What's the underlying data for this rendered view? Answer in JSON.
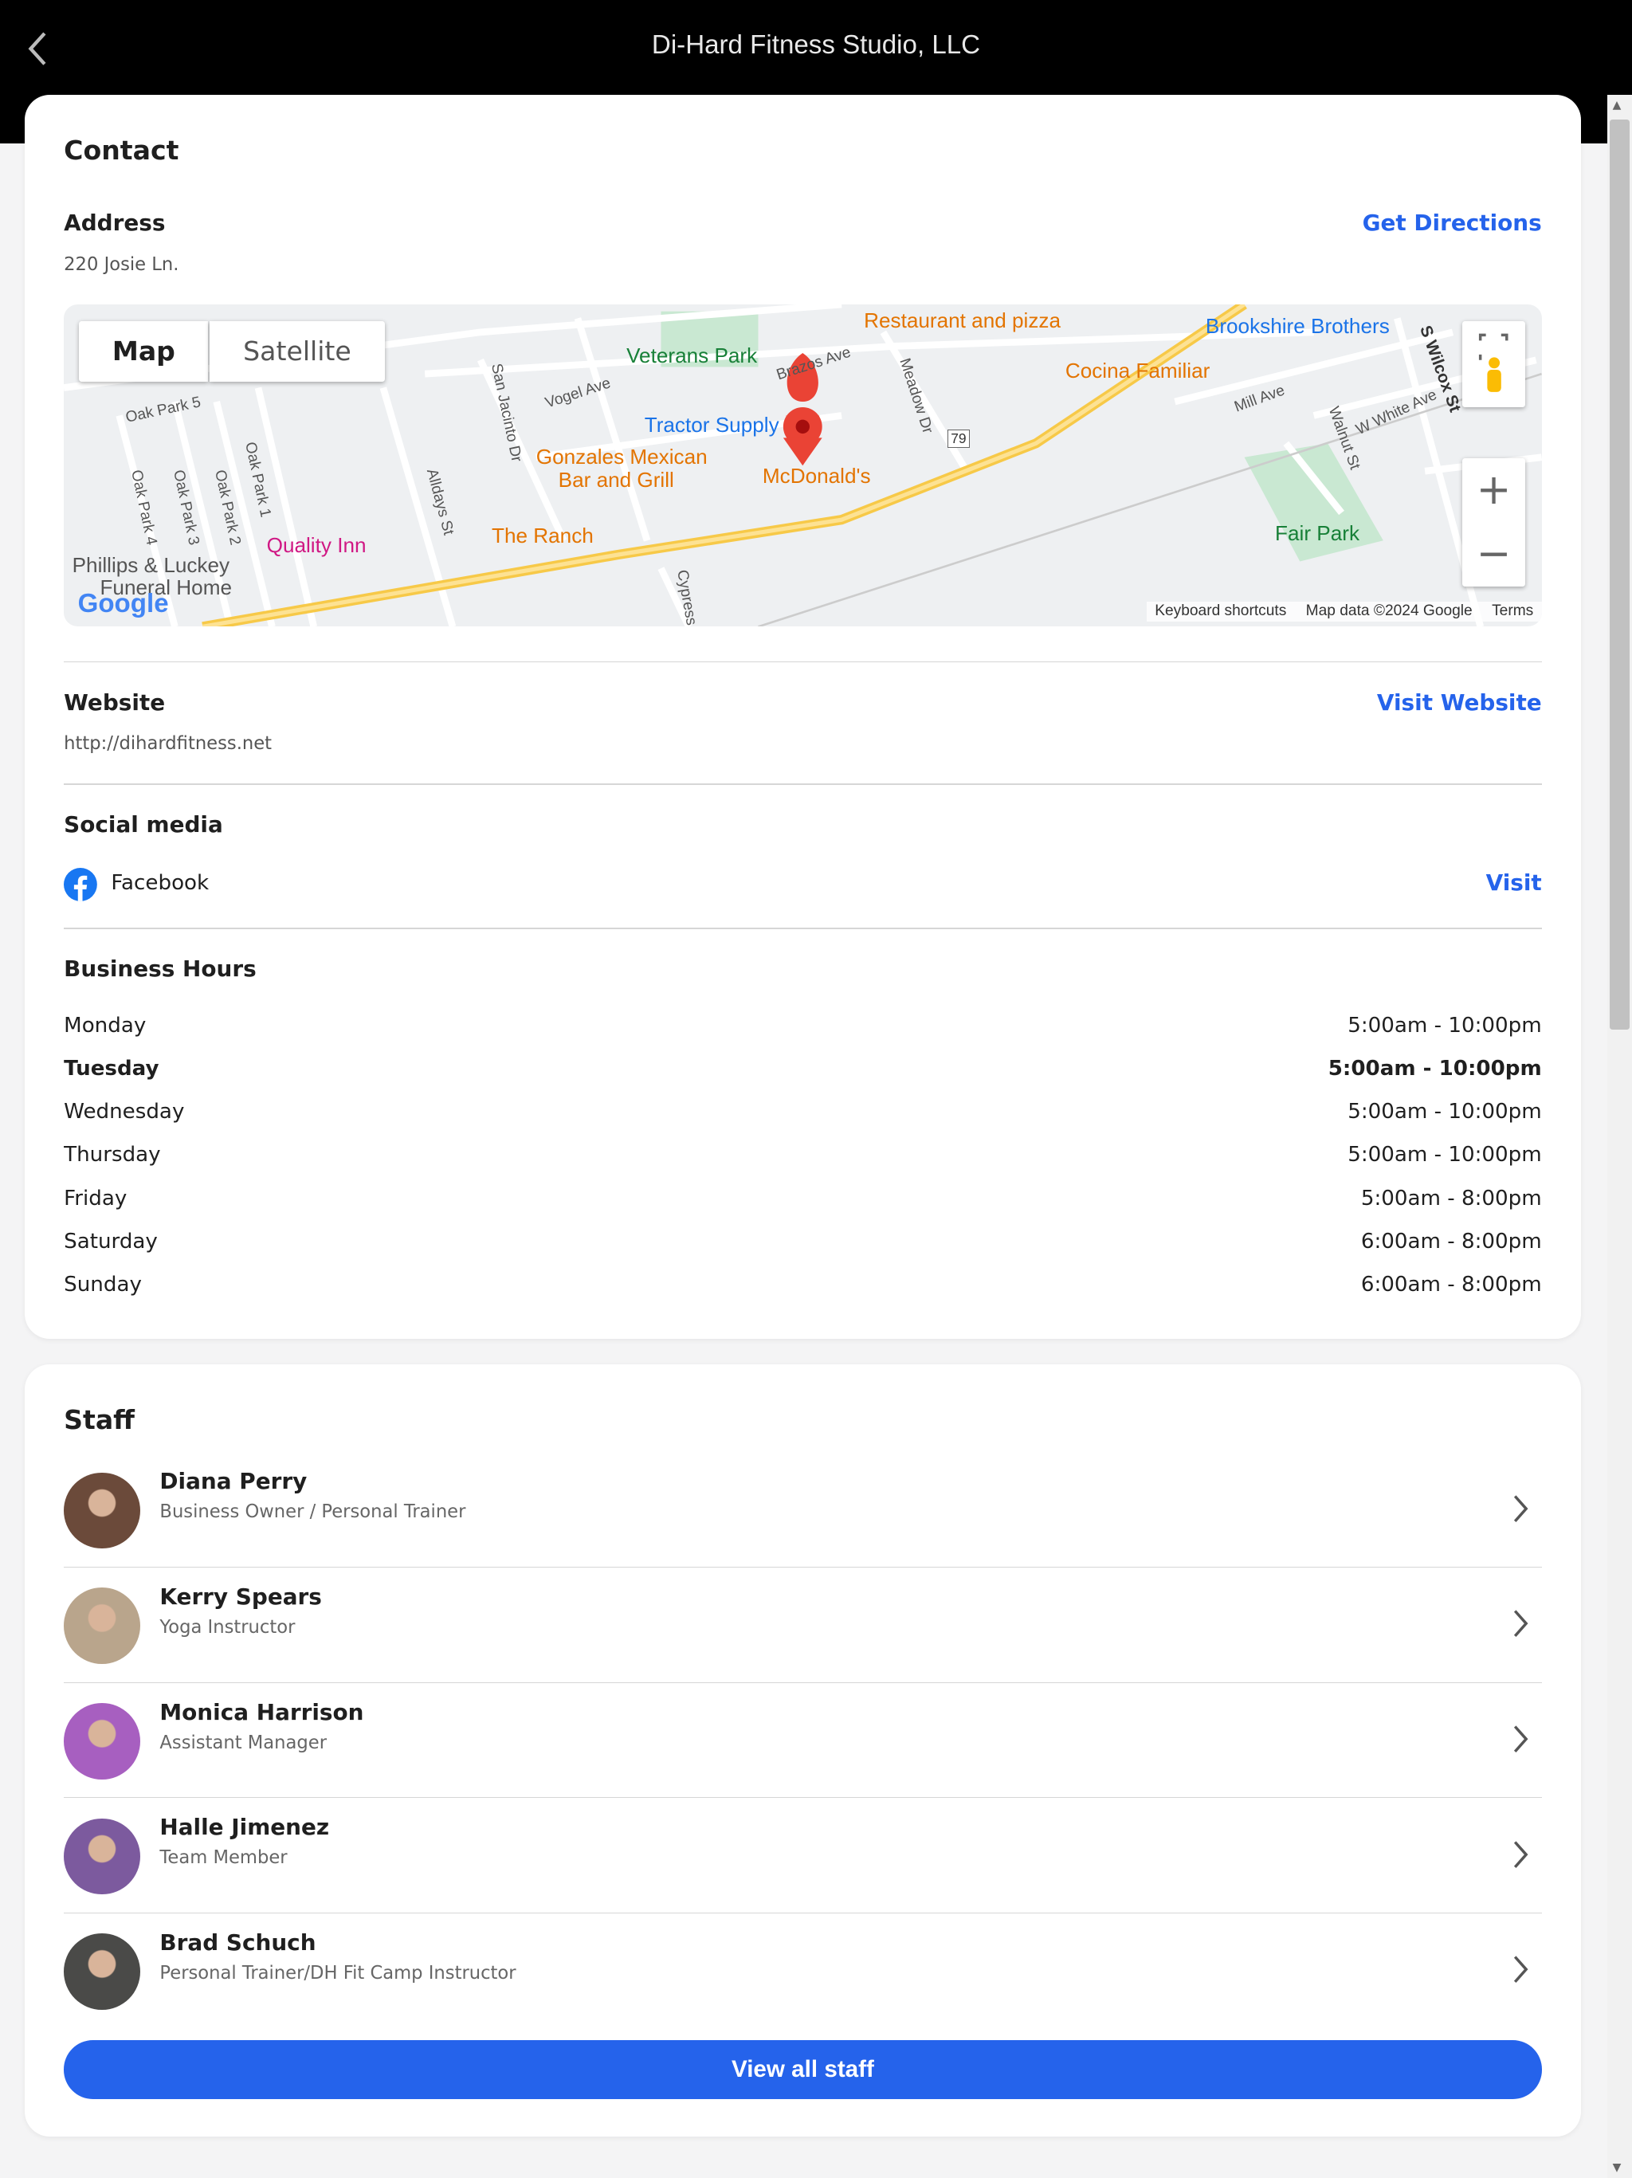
{
  "header": {
    "title": "Di-Hard Fitness Studio, LLC",
    "back_icon": "chevron-left-icon"
  },
  "contact": {
    "heading": "Contact",
    "address_label": "Address",
    "address": "220 Josie Ln.",
    "directions_link": "Get Directions",
    "map": {
      "tabs": [
        "Map",
        "Satellite"
      ],
      "active_tab": "Map",
      "labels": [
        "Veterans Park",
        "Tractor Supply",
        "Gonzales Mexican",
        "Bar and Grill",
        "McDonald's",
        "The Ranch",
        "Quality Inn",
        "Phillips & Luckey",
        "Funeral Home",
        "Restaurant and pizza",
        "Cocina Familiar",
        "Brookshire Brothers",
        "Fair Park",
        "Oak Park 5",
        "Oak Park 4",
        "Oak Park 3",
        "Oak Park 2",
        "Oak Park 1",
        "Vogel Ave",
        "Brazos Ave",
        "San Jacinto Dr",
        "Meadow Dr",
        "Alldays St",
        "Cypress",
        "Mill Ave",
        "Walnut St",
        "W White Ave",
        "S Wilcox St",
        "79"
      ],
      "footer": {
        "shortcuts": "Keyboard shortcuts",
        "attribution": "Map data ©2024 Google",
        "terms": "Terms"
      },
      "logo": "Google"
    },
    "website_label": "Website",
    "website": "http://dihardfitness.net",
    "website_link": "Visit Website",
    "social_label": "Social media",
    "social": [
      {
        "name": "Facebook",
        "icon": "facebook-icon",
        "link": "Visit"
      }
    ],
    "hours_label": "Business Hours",
    "hours": [
      {
        "day": "Monday",
        "time": "5:00am - 10:00pm",
        "today": false
      },
      {
        "day": "Tuesday",
        "time": "5:00am - 10:00pm",
        "today": true
      },
      {
        "day": "Wednesday",
        "time": "5:00am - 10:00pm",
        "today": false
      },
      {
        "day": "Thursday",
        "time": "5:00am - 10:00pm",
        "today": false
      },
      {
        "day": "Friday",
        "time": "5:00am - 8:00pm",
        "today": false
      },
      {
        "day": "Saturday",
        "time": "6:00am - 8:00pm",
        "today": false
      },
      {
        "day": "Sunday",
        "time": "6:00am - 8:00pm",
        "today": false
      }
    ]
  },
  "staff": {
    "heading": "Staff",
    "members": [
      {
        "name": "Diana Perry",
        "role": "Business Owner / Personal Trainer",
        "avatar_color": "#6b4a3a"
      },
      {
        "name": "Kerry Spears",
        "role": "Yoga Instructor",
        "avatar_color": "#b9a58c"
      },
      {
        "name": "Monica Harrison",
        "role": "Assistant Manager",
        "avatar_color": "#a75fc0"
      },
      {
        "name": "Halle Jimenez",
        "role": "Team Member",
        "avatar_color": "#7c5a9e"
      },
      {
        "name": "Brad Schuch",
        "role": "Personal Trainer/DH Fit Camp Instructor",
        "avatar_color": "#4a4a48"
      }
    ],
    "view_all": "View all staff"
  },
  "colors": {
    "accent": "#2563eb",
    "header_bg": "#000000"
  }
}
